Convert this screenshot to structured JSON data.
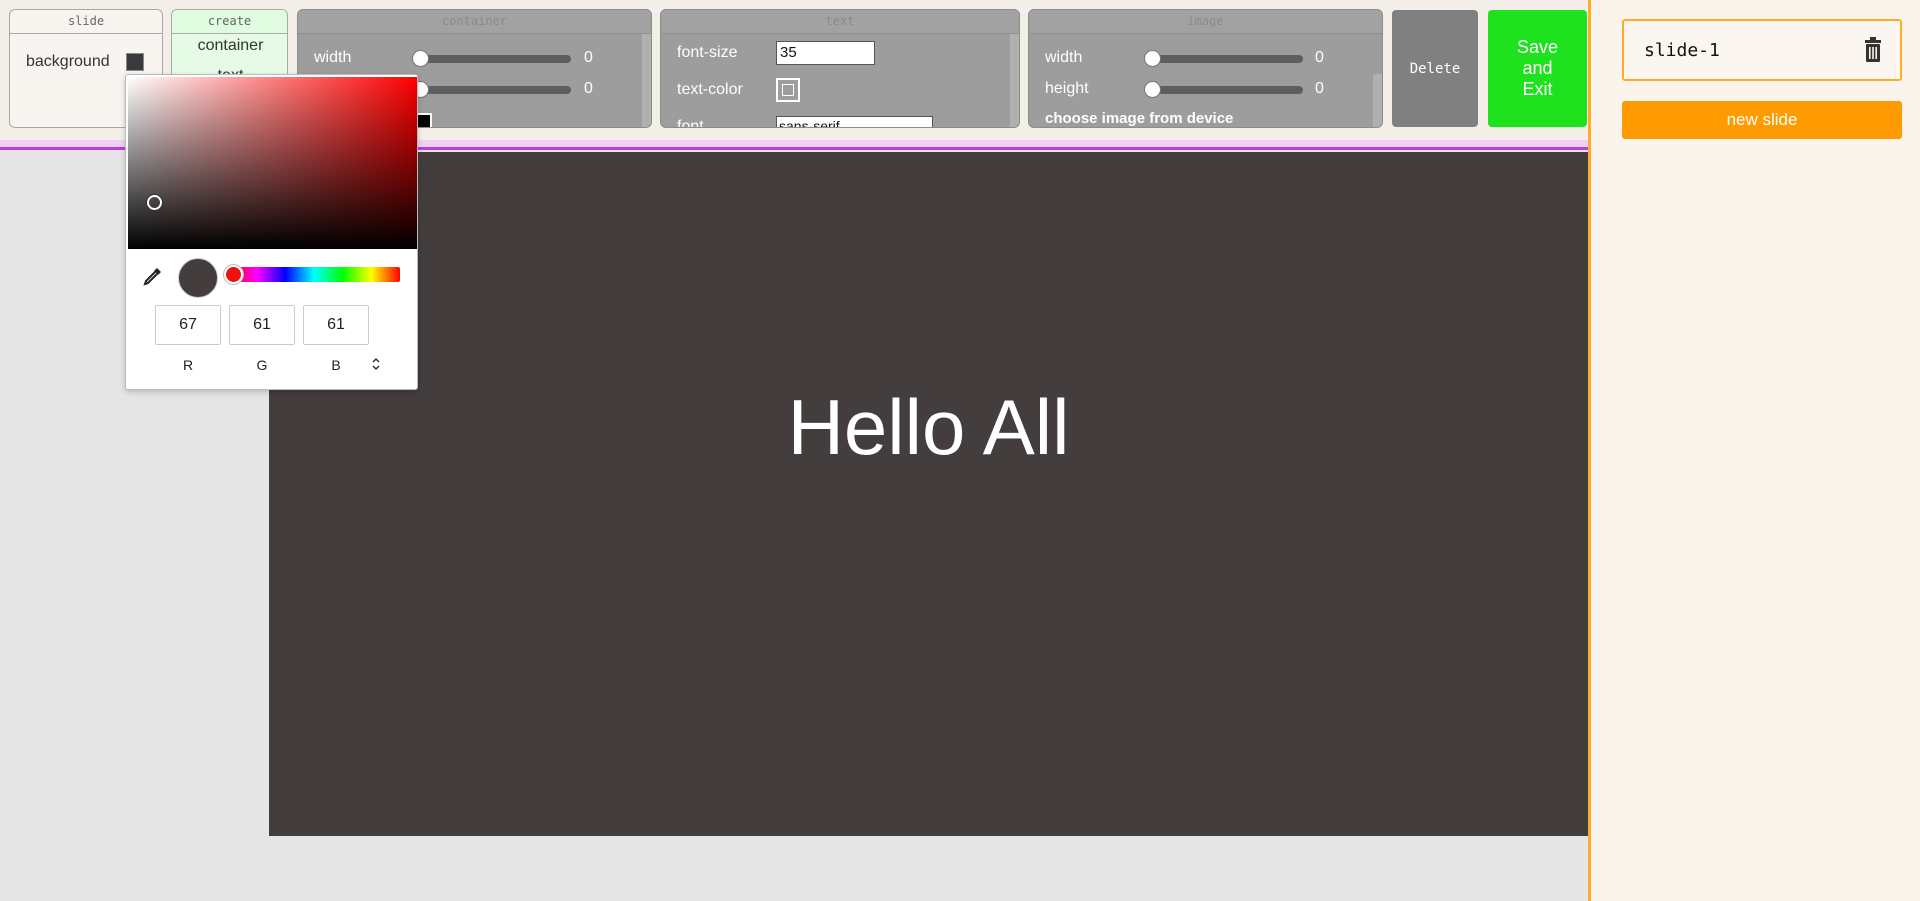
{
  "toolbar": {
    "slide_panel": {
      "title": "slide",
      "background_label": "background",
      "background_color": "#3a3a3a"
    },
    "create_panel": {
      "title": "create",
      "items": [
        "container",
        "text"
      ]
    },
    "container_panel": {
      "title": "container",
      "width_label": "width",
      "width_value": "0",
      "height_value": "0",
      "color_swatch": "#000000"
    },
    "text_panel": {
      "title": "text",
      "font_size_label": "font-size",
      "font_size_value": "35",
      "text_color_label": "text-color",
      "font_label": "font",
      "font_value": "sans-serif"
    },
    "image_panel": {
      "title": "image",
      "width_label": "width",
      "width_value": "0",
      "height_label": "height",
      "height_value": "0",
      "choose_label": "choose image from device"
    },
    "delete_label": "Delete",
    "save_label": "Save and Exit"
  },
  "canvas": {
    "background": "#433d3d",
    "text": "Hello All"
  },
  "sidebar": {
    "slides": [
      {
        "label": "slide-1"
      }
    ],
    "new_slide_label": "new slide"
  },
  "color_picker": {
    "r": "67",
    "g": "61",
    "b": "61",
    "r_label": "R",
    "g_label": "G",
    "b_label": "B",
    "current_color": "#433d3d",
    "hue_color": "#ff0000"
  }
}
